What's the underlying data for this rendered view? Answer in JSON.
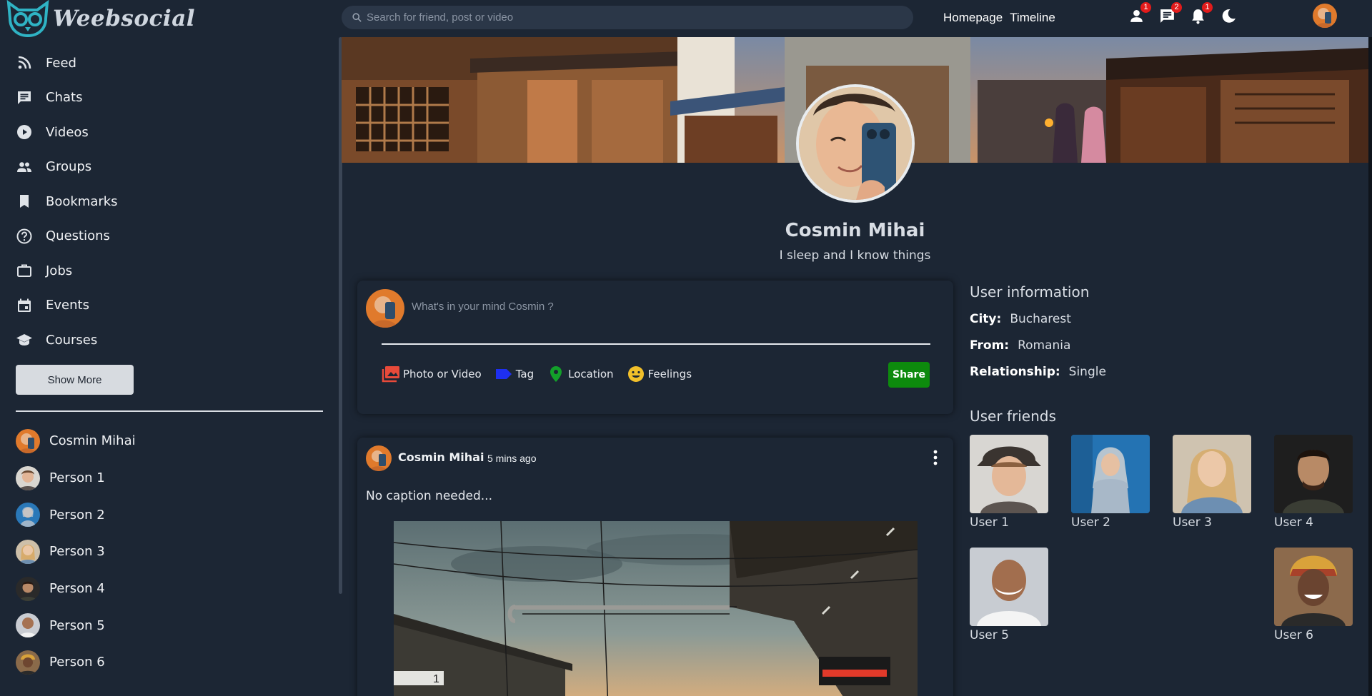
{
  "app": {
    "logo_text": "Weebsocial",
    "search_placeholder": "Search for friend, post or video",
    "links": {
      "homepage": "Homepage",
      "timeline": "Timeline"
    },
    "badges": {
      "friends": "1",
      "messages": "2",
      "notifications": "1"
    }
  },
  "sidebar": {
    "items": [
      {
        "label": "Feed",
        "icon": "rss-icon"
      },
      {
        "label": "Chats",
        "icon": "chat-icon"
      },
      {
        "label": "Videos",
        "icon": "play-circle-icon"
      },
      {
        "label": "Groups",
        "icon": "group-icon"
      },
      {
        "label": "Bookmarks",
        "icon": "bookmark-icon"
      },
      {
        "label": "Questions",
        "icon": "help-circle-icon"
      },
      {
        "label": "Jobs",
        "icon": "briefcase-icon"
      },
      {
        "label": "Events",
        "icon": "calendar-icon"
      },
      {
        "label": "Courses",
        "icon": "school-icon"
      }
    ],
    "show_more": "Show More",
    "friends": [
      {
        "name": "Cosmin Mihai"
      },
      {
        "name": "Person 1"
      },
      {
        "name": "Person 2"
      },
      {
        "name": "Person 3"
      },
      {
        "name": "Person 4"
      },
      {
        "name": "Person 5"
      },
      {
        "name": "Person 6"
      }
    ]
  },
  "profile": {
    "name": "Cosmin Mihai",
    "bio": "I sleep and I know things"
  },
  "share": {
    "placeholder": "What's in your mind Cosmin ?",
    "options": {
      "photo": "Photo or Video",
      "tag": "Tag",
      "location": "Location",
      "feelings": "Feelings"
    },
    "button": "Share"
  },
  "post": {
    "author": "Cosmin Mihai",
    "time": "5 mins ago",
    "caption": "No caption needed..."
  },
  "user_info": {
    "title": "User information",
    "city": {
      "label": "City:",
      "value": "Bucharest"
    },
    "from": {
      "label": "From:",
      "value": "Romania"
    },
    "relationship": {
      "label": "Relationship:",
      "value": "Single"
    }
  },
  "user_friends": {
    "title": "User friends",
    "list": [
      "User 1",
      "User 2",
      "User 3",
      "User 4",
      "User 5",
      "User 6"
    ]
  },
  "colors": {
    "background": "#1c2634",
    "search_bg": "#2b3748",
    "badge": "#e21b1b",
    "share_button": "#0d8a0d",
    "logo_accent": "#2fb3c4"
  }
}
